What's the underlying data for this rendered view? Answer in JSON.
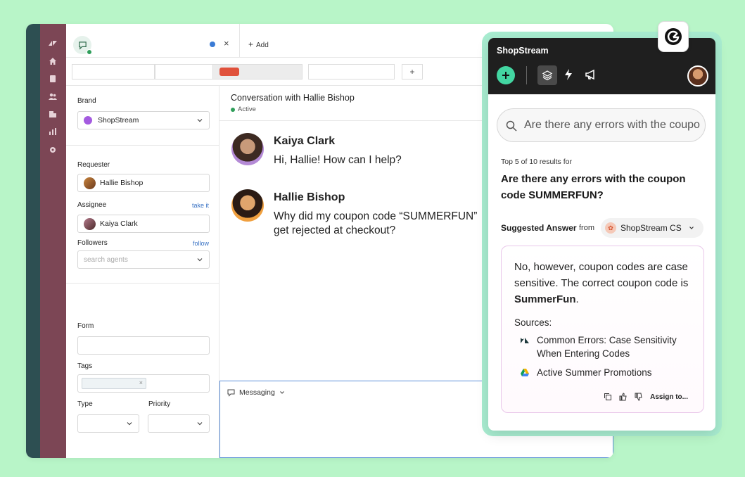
{
  "tabs": {
    "add_label": "Add",
    "close_glyph": "×",
    "plus_glyph": "+"
  },
  "left_panel": {
    "brand_label": "Brand",
    "brand_value": "ShopStream",
    "requester_label": "Requester",
    "requester_value": "Hallie Bishop",
    "assignee_label": "Assignee",
    "assignee_link": "take it",
    "assignee_value": "Kaiya Clark",
    "followers_label": "Followers",
    "followers_link": "follow",
    "followers_placeholder": "search agents",
    "form_label": "Form",
    "tags_label": "Tags",
    "tag_close_glyph": "×",
    "type_label": "Type",
    "priority_label": "Priority"
  },
  "conversation": {
    "title": "Conversation with Hallie Bishop",
    "status": "Active",
    "messages": [
      {
        "author": "Kaiya Clark",
        "text": "Hi, Hallie! How can I help?"
      },
      {
        "author": "Hallie Bishop",
        "text_line1": "Why did my coupon code “SUMMERFUN”",
        "text_line2": "get rejected at checkout?"
      }
    ],
    "composer_channel": "Messaging"
  },
  "assistant": {
    "app_name": "ShopStream",
    "search_value": "Are there any errors with the coupon code SUMMERFUN?",
    "results_meta": "Top 5 of 10 results for",
    "question": "Are there any errors with the coupon code SUMMERFUN?",
    "suggested_label": "Suggested Answer",
    "from_label": "from",
    "source_name": "ShopStream CS",
    "answer_part1": "No, however, coupon codes are case sensitive. The correct coupon code is ",
    "answer_bold": "SummerFun",
    "answer_end": ".",
    "sources_label": "Sources:",
    "sources": [
      {
        "icon": "zendesk-icon",
        "line1": "Common Errors: Case Sensitivity",
        "line2": "When Entering Codes"
      },
      {
        "icon": "google-drive-icon",
        "line1": "Active Summer Promotions"
      }
    ],
    "assign_label": "Assign to..."
  },
  "colors": {
    "accent_green": "#43d6a2",
    "rail": "#7c4655",
    "background": "#b8f5c8"
  }
}
